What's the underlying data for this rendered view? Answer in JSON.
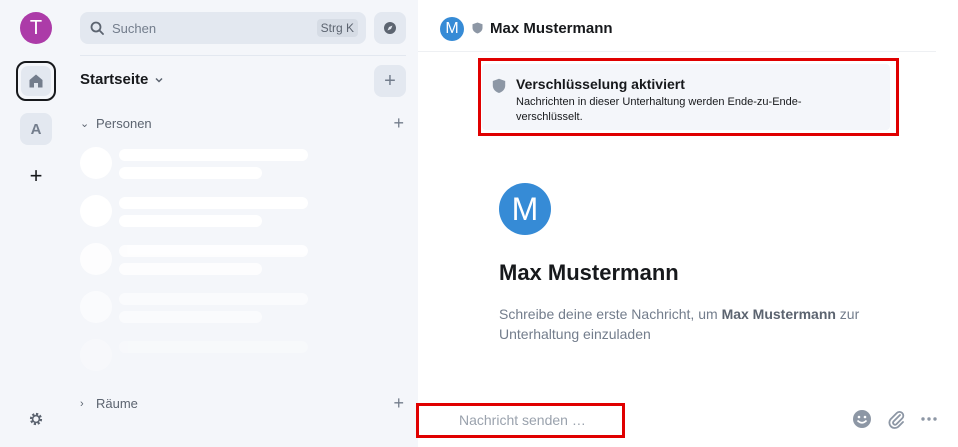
{
  "rail": {
    "user_initial": "T",
    "user_color": "#ac3ba8",
    "space_initial": "A",
    "add_space_label": "+"
  },
  "roomlist": {
    "search_label": "Suchen",
    "search_shortcut": "Strg K",
    "home_title": "Startseite",
    "add_room_label": "+",
    "sections": {
      "people": "Personen",
      "rooms": "Räume"
    }
  },
  "header": {
    "avatar_initial": "M",
    "name": "Max Mustermann",
    "avatar_color": "#368bd6"
  },
  "encryption_notice": {
    "title": "Verschlüsselung aktiviert",
    "description": "Nachrichten in dieser Unterhaltung werden Ende-zu-Ende-verschlüsselt."
  },
  "intro": {
    "avatar_initial": "M",
    "name": "Max Mustermann",
    "text_before": "Schreibe deine erste Nachricht, um ",
    "text_name": "Max Mustermann",
    "text_after": " zur Unterhaltung einzuladen"
  },
  "composer": {
    "placeholder": "Nachricht senden …"
  },
  "icons": {
    "home": "home-icon",
    "settings": "gear-icon",
    "search": "search-icon",
    "explore": "compass-icon",
    "shield": "shield-icon",
    "emoji": "emoji-icon",
    "attachment": "paperclip-icon",
    "more": "more-options-icon"
  },
  "colors": {
    "highlight": "#e00000",
    "panel": "#f4f6fa",
    "accent": "#368bd6"
  }
}
